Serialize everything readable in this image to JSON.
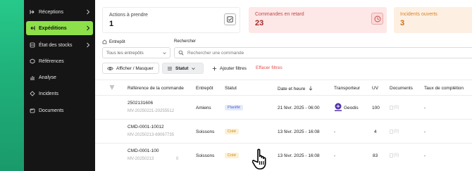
{
  "sidebar": {
    "items": [
      {
        "label": "Réceptions",
        "icon": "reception-icon",
        "has_chevron": true,
        "active": false
      },
      {
        "label": "Expéditions",
        "icon": "shipping-icon",
        "has_chevron": true,
        "active": true
      },
      {
        "label": "État des stocks",
        "icon": "stock-icon",
        "has_chevron": true,
        "active": false
      },
      {
        "label": "Références",
        "icon": "references-icon",
        "has_chevron": false,
        "active": false
      },
      {
        "label": "Analyse",
        "icon": "analysis-icon",
        "has_chevron": false,
        "active": false
      },
      {
        "label": "Incidents",
        "icon": "incident-icon",
        "has_chevron": false,
        "active": false
      },
      {
        "label": "Documents",
        "icon": "documents-icon",
        "has_chevron": false,
        "active": false
      }
    ]
  },
  "cards": [
    {
      "label": "Actions à prendre",
      "value": "1",
      "icon": "checkbox-icon"
    },
    {
      "label": "Commandes en retard",
      "value": "23",
      "icon": "clock-icon"
    },
    {
      "label": "Incidents ouverts",
      "value": "3",
      "icon": "alert-icon"
    }
  ],
  "filters": {
    "warehouse_label": "Entrepôt",
    "warehouse_value": "Tous les entrepôts",
    "search_label": "Rechercher",
    "search_placeholder": "Rechercher une commande",
    "display_btn": "Afficher / Masquer",
    "status_btn": "Statut",
    "add_filters_btn": "Ajouter filtres",
    "clear_btn": "Effacer filtres"
  },
  "table": {
    "columns": [
      "Référence de la commande",
      "Entrepôt",
      "Statut",
      "Date et heure",
      "Transporteur",
      "UV",
      "Documents",
      "Taux de complétion"
    ],
    "rows": [
      {
        "ref": "2502131606",
        "sub": "MV-20250221-20255512",
        "warehouse": "Amiens",
        "status": "Planifié",
        "status_kind": "plan",
        "date": "21 févr. 2025 - 06:00",
        "carrier": "Geodis",
        "uv": "100",
        "docs": "(0)",
        "completion": "-"
      },
      {
        "ref": "CMD-0001-10012",
        "sub": "MV-20250213-69067735",
        "warehouse": "Soissons",
        "status": "Créé",
        "status_kind": "cree",
        "date": "13 févr. 2025 - 16:08",
        "carrier": "-",
        "uv": "4",
        "docs": "(0)",
        "completion": "-"
      },
      {
        "ref": "CMD-0001-100",
        "sub": "MV-20250213",
        "sub_tail": "0",
        "warehouse": "Soissons",
        "status": "Créé",
        "status_kind": "cree",
        "date": "13 févr. 2025 - 16:08",
        "carrier": "-",
        "uv": "83",
        "docs": "(0)",
        "completion": "-"
      }
    ]
  },
  "colors": {
    "accent_green": "#8ee04a",
    "late_red": "#d23f3f",
    "incident_orange": "#e48f2a",
    "clear_red": "#e2514c",
    "geodis_purple": "#4b2aa8"
  }
}
